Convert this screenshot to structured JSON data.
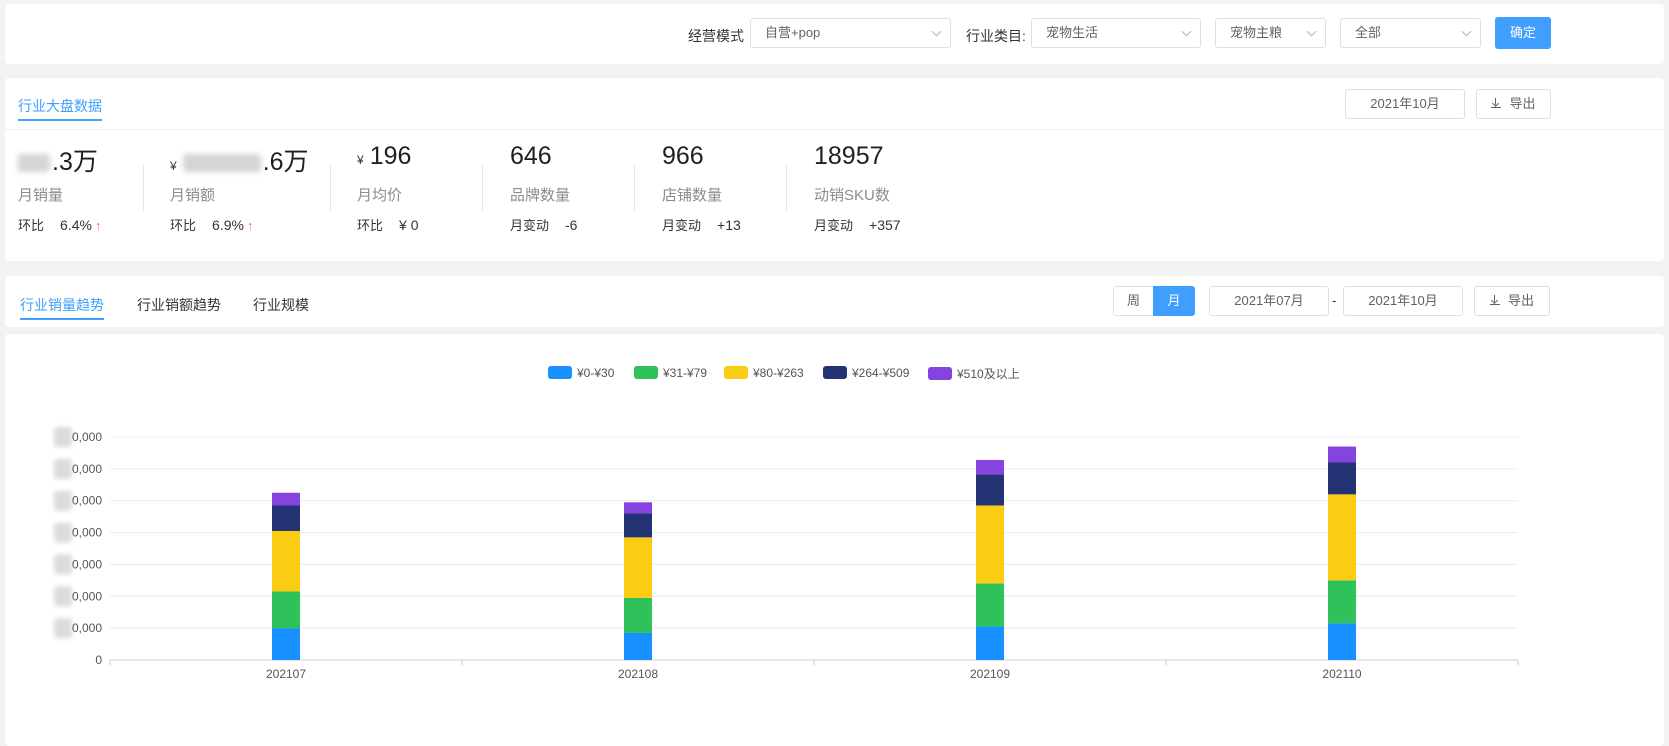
{
  "filters": {
    "mode_label": "经营模式",
    "mode_value": "自营+pop",
    "category_label": "行业类目:",
    "category_l1": "宠物生活",
    "category_l2": "宠物主粮",
    "category_l3": "全部",
    "confirm": "确定"
  },
  "overview": {
    "tab": "行业大盘数据",
    "month": "2021年10月",
    "export": "导出",
    "metrics": [
      {
        "value": ".3万",
        "label": "月销量",
        "sub_label": "环比",
        "sub_value": "6.4%",
        "trend": "↑"
      },
      {
        "value": ".6万",
        "label": "月销额",
        "sub_label": "环比",
        "sub_value": "6.9%",
        "trend": "↑"
      },
      {
        "currency": "¥",
        "value": "196",
        "label": "月均价",
        "sub_label": "环比",
        "sub_value": "¥ 0"
      },
      {
        "value": "646",
        "label": "品牌数量",
        "sub_label": "月变动",
        "sub_value": "-6"
      },
      {
        "value": "966",
        "label": "店铺数量",
        "sub_label": "月变动",
        "sub_value": "+13"
      },
      {
        "value": "18957",
        "label": "动销SKU数",
        "sub_label": "月变动",
        "sub_value": "+357"
      }
    ]
  },
  "trend": {
    "tabs": [
      "行业销量趋势",
      "行业销额趋势",
      "行业规模"
    ],
    "period_week": "周",
    "period_month": "月",
    "date_from": "2021年07月",
    "date_sep": "-",
    "date_to": "2021年10月",
    "export": "导出"
  },
  "chart_data": {
    "type": "bar",
    "stacked": true,
    "categories": [
      "202107",
      "202108",
      "202109",
      "202110"
    ],
    "y_tick_labels": [
      "0",
      "0,000",
      "0,000",
      "0,000",
      "0,000",
      "0,000",
      "0,000",
      "0,000"
    ],
    "grid": true,
    "legend_position": "top",
    "series": [
      {
        "name": "¥0-¥30",
        "color": "#1890ff",
        "values": [
          1.0,
          0.85,
          1.05,
          1.15
        ]
      },
      {
        "name": "¥31-¥79",
        "color": "#2fc25b",
        "values": [
          1.15,
          1.1,
          1.35,
          1.35
        ]
      },
      {
        "name": "¥80-¥263",
        "color": "#facc14",
        "values": [
          1.9,
          1.9,
          2.45,
          2.7
        ]
      },
      {
        "name": "¥264-¥509",
        "color": "#223273",
        "values": [
          0.8,
          0.75,
          0.98,
          1.0
        ]
      },
      {
        "name": "¥510及以上",
        "color": "#8543e0",
        "values": [
          0.4,
          0.35,
          0.45,
          0.5
        ]
      }
    ],
    "ylim": [
      0,
      7
    ]
  }
}
